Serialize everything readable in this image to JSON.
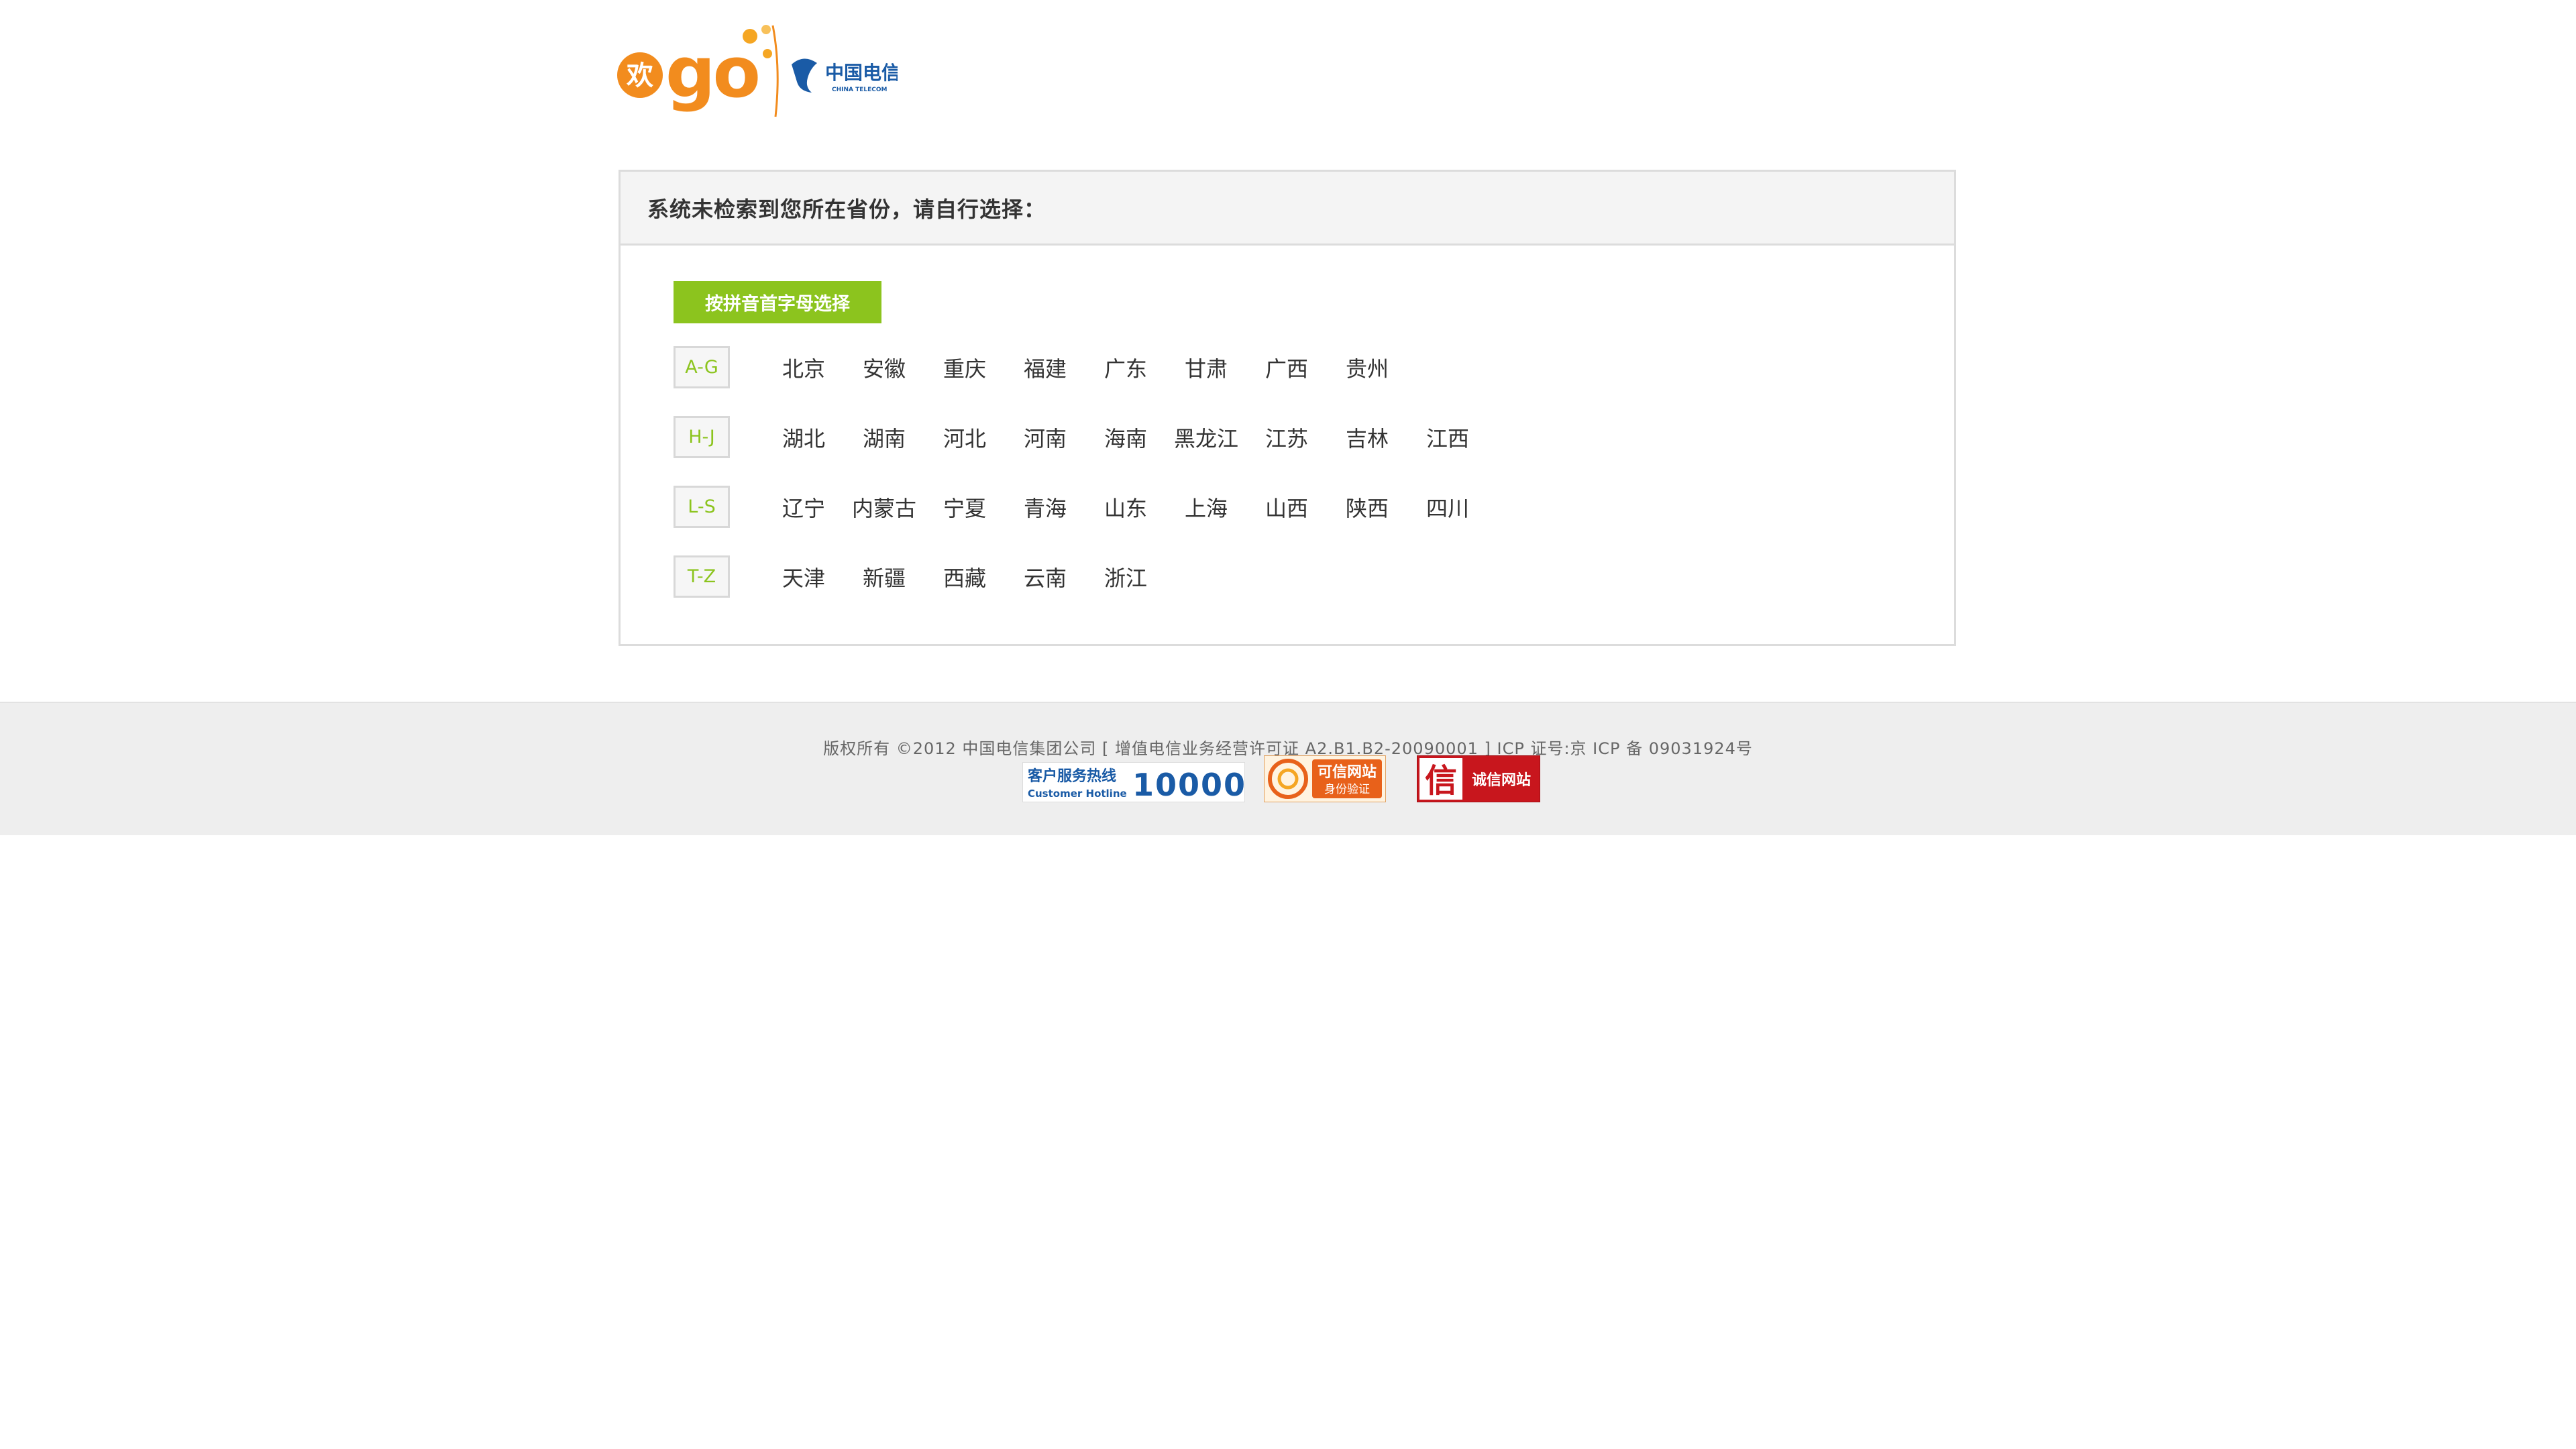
{
  "logo": {
    "brand_cn": "欢",
    "brand_en": "go",
    "partner_cn": "中国电信",
    "partner_en": "CHINA TELECOM"
  },
  "panel": {
    "title": "系统未检索到您所在省份，请自行选择：",
    "tab_label": "按拼音首字母选择",
    "groups": [
      {
        "letter": "A-G",
        "provinces": [
          "北京",
          "安徽",
          "重庆",
          "福建",
          "广东",
          "甘肃",
          "广西",
          "贵州"
        ]
      },
      {
        "letter": "H-J",
        "provinces": [
          "湖北",
          "湖南",
          "河北",
          "河南",
          "海南",
          "黑龙江",
          "江苏",
          "吉林",
          "江西"
        ]
      },
      {
        "letter": "L-S",
        "provinces": [
          "辽宁",
          "内蒙古",
          "宁夏",
          "青海",
          "山东",
          "上海",
          "山西",
          "陕西",
          "四川"
        ]
      },
      {
        "letter": "T-Z",
        "provinces": [
          "天津",
          "新疆",
          "西藏",
          "云南",
          "浙江"
        ]
      }
    ]
  },
  "footer": {
    "copyright": "版权所有 ©2012 中国电信集团公司 [ 增值电信业务经营许可证 A2.B1.B2-20090001 ] ICP 证号:京 ICP 备 09031924号",
    "badge_hotline_cn": "客户服务热线",
    "badge_hotline_en": "Customer Hotline",
    "badge_hotline_number": "10000",
    "badge_trusted_title": "可信网站",
    "badge_trusted_sub": "身份验证",
    "badge_integrity_char": "信",
    "badge_integrity_title": "诚信网站"
  },
  "colors": {
    "accent": "#8cc41e",
    "logo_orange": "#f28c1e",
    "telecom_blue": "#1a5ba6",
    "footer_bg": "#eeeeee"
  }
}
